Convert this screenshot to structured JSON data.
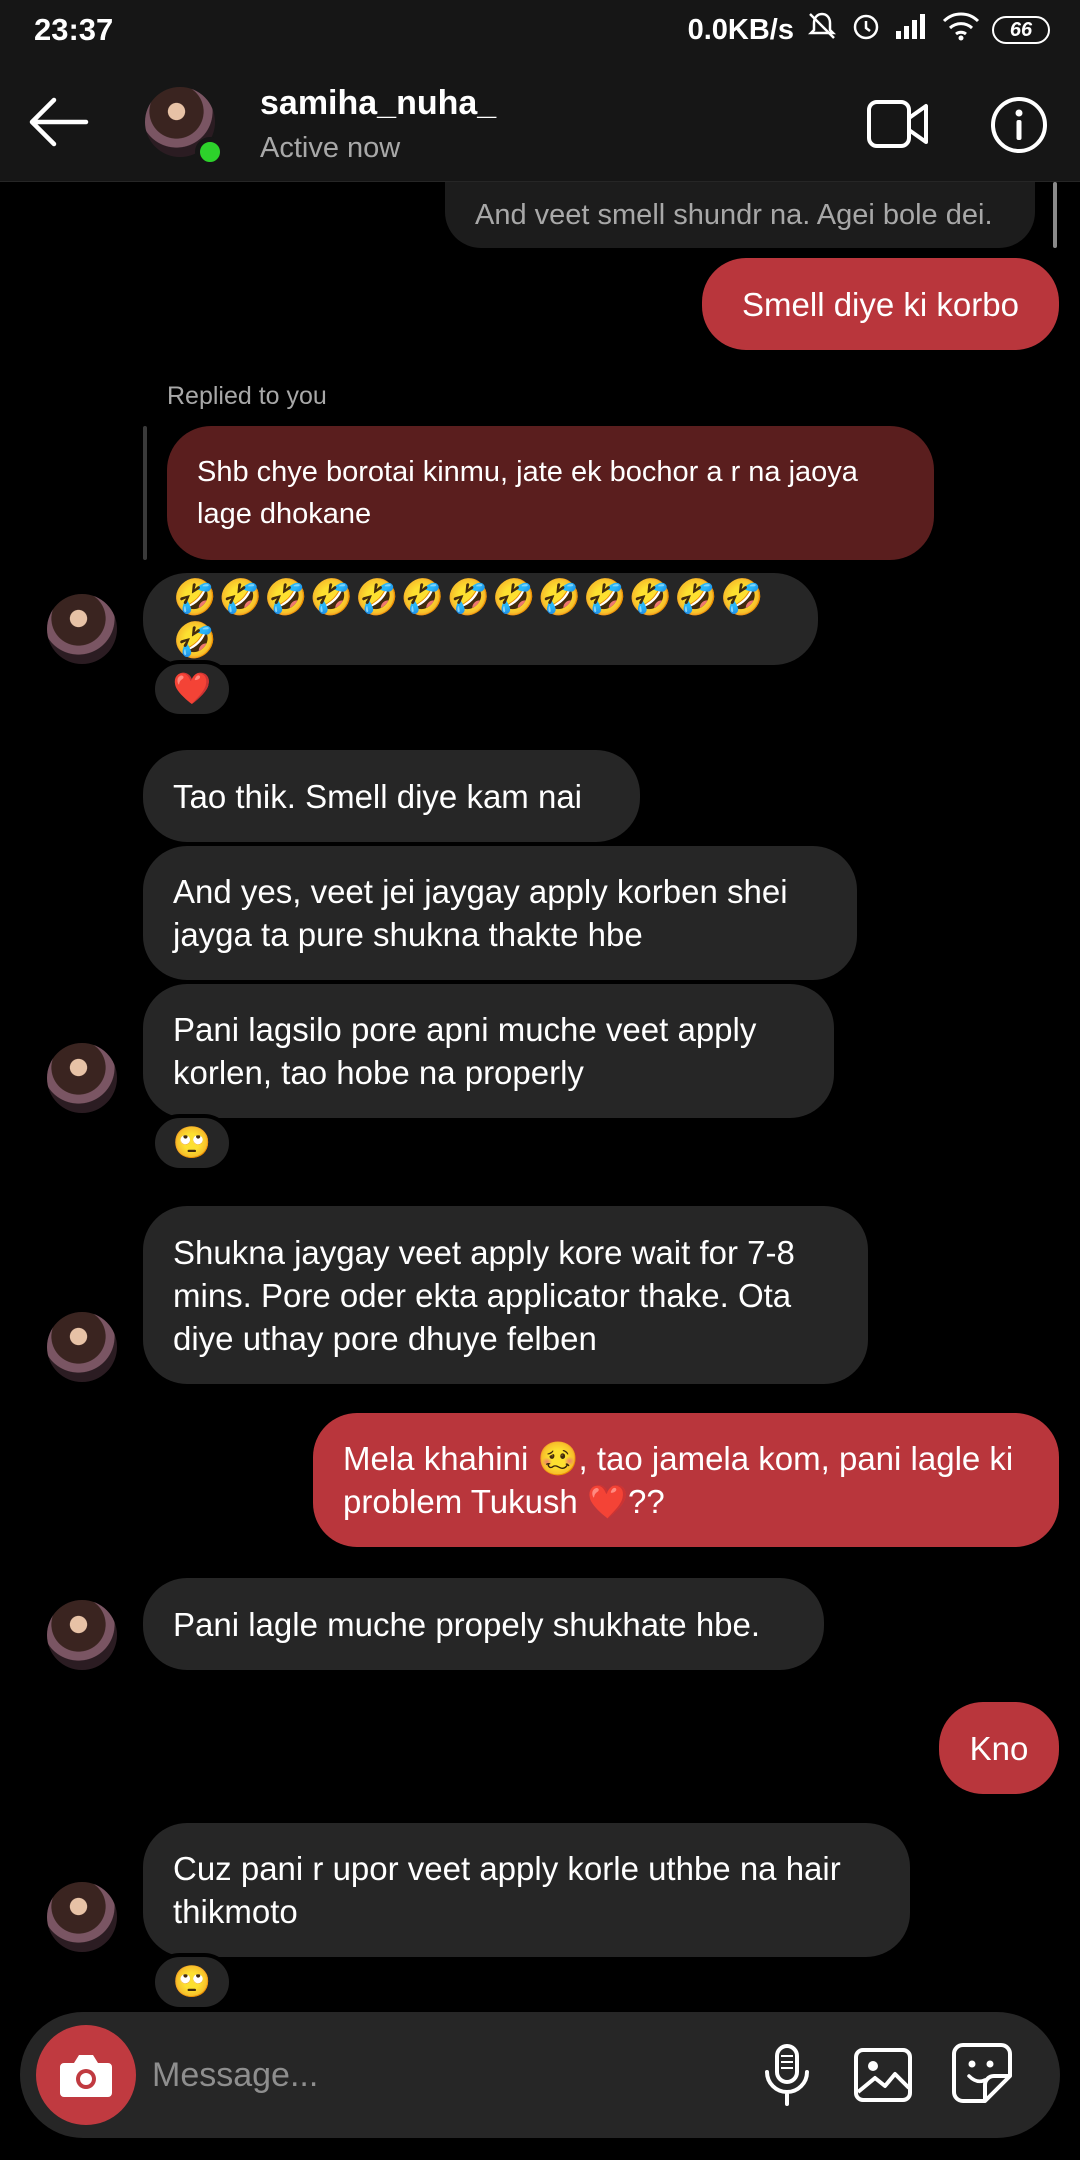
{
  "status_bar": {
    "time": "23:37",
    "net_speed": "0.0KB/s",
    "battery": "66",
    "icons": [
      "mute-icon",
      "alarm-icon",
      "signal-icon",
      "wifi-icon",
      "battery-icon"
    ]
  },
  "header": {
    "username": "samiha_nuha_",
    "status": "Active now",
    "icons": [
      "back-arrow-icon",
      "video-call-icon",
      "info-icon"
    ]
  },
  "messages": [
    {
      "side": "received",
      "text": "And veet smell shundr na. Agei bole dei."
    },
    {
      "side": "sent",
      "text": "Smell diye ki korbo"
    },
    {
      "side": "received",
      "replied_label": "Replied to you",
      "quoted": "Shb chye borotai kinmu, jate ek bochor a r na jaoya lage dhokane"
    },
    {
      "side": "received",
      "text": "🤣🤣🤣🤣🤣🤣🤣🤣🤣🤣🤣🤣🤣🤣",
      "reaction": "❤️"
    },
    {
      "side": "received",
      "text": "Tao thik. Smell diye kam nai"
    },
    {
      "side": "received",
      "text": "And yes, veet jei jaygay apply korben shei jayga ta pure shukna thakte hbe"
    },
    {
      "side": "received",
      "text": "Pani lagsilo pore apni muche veet apply korlen, tao hobe na properly",
      "reaction": "🙄"
    },
    {
      "side": "received",
      "text": "Shukna jaygay veet apply kore wait for 7-8 mins. Pore oder ekta applicator thake. Ota diye uthay pore dhuye felben"
    },
    {
      "side": "sent",
      "text": "Mela khahini 🥴, tao jamela kom, pani lagle ki problem Tukush ❤️??"
    },
    {
      "side": "received",
      "text": "Pani lagle muche propely shukhate hbe."
    },
    {
      "side": "sent",
      "text": "Kno"
    },
    {
      "side": "received",
      "text": "Cuz pani r upor veet apply korle uthbe na hair thikmoto",
      "reaction": "🙄"
    }
  ],
  "composer": {
    "placeholder": "Message...",
    "icons": [
      "camera-icon",
      "microphone-icon",
      "gallery-icon",
      "sticker-icon"
    ]
  },
  "colors": {
    "sent_bubble": "#b9363c",
    "received_bubble": "#262626",
    "quoted_bubble": "#5a1e1e",
    "online": "#2dd22b"
  }
}
